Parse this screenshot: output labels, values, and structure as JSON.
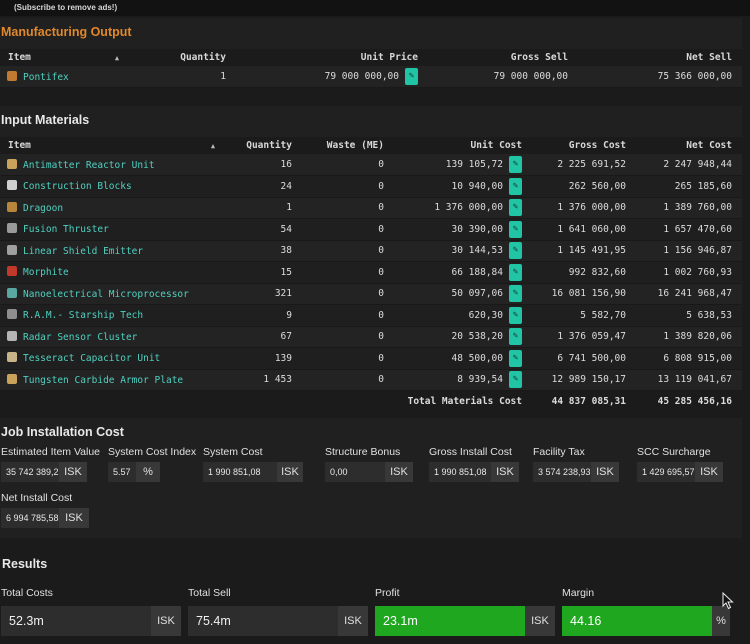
{
  "ad_note": "(Subscribe to remove ads!)",
  "output": {
    "title": "Manufacturing Output",
    "headers": [
      "Item",
      "Quantity",
      "Unit Price",
      "Gross Sell",
      "Net Sell"
    ],
    "rows": [
      {
        "name": "Pontifex",
        "qty": "1",
        "unit_price": "79 000 000,00",
        "gross": "79 000 000,00",
        "net": "75 366 000,00",
        "icon_color": "#c27a30"
      }
    ]
  },
  "materials": {
    "title": "Input Materials",
    "headers": [
      "Item",
      "Quantity",
      "Waste (ME)",
      "Unit Cost",
      "Gross Cost",
      "Net Cost"
    ],
    "rows": [
      {
        "name": "Antimatter Reactor Unit",
        "qty": "16",
        "waste": "0",
        "unit": "139 105,72",
        "gross": "2 225 691,52",
        "net": "2 247 948,44",
        "icon_color": "#c9a35a"
      },
      {
        "name": "Construction Blocks",
        "qty": "24",
        "waste": "0",
        "unit": "10 940,00",
        "gross": "262 560,00",
        "net": "265 185,60",
        "icon_color": "#cfcfcf"
      },
      {
        "name": "Dragoon",
        "qty": "1",
        "waste": "0",
        "unit": "1 376 000,00",
        "gross": "1 376 000,00",
        "net": "1 389 760,00",
        "icon_color": "#b8863a"
      },
      {
        "name": "Fusion Thruster",
        "qty": "54",
        "waste": "0",
        "unit": "30 390,00",
        "gross": "1 641 060,00",
        "net": "1 657 470,60",
        "icon_color": "#9a9a9a"
      },
      {
        "name": "Linear Shield Emitter",
        "qty": "38",
        "waste": "0",
        "unit": "30 144,53",
        "gross": "1 145 491,95",
        "net": "1 156 946,87",
        "icon_color": "#a0a0a0"
      },
      {
        "name": "Morphite",
        "qty": "15",
        "waste": "0",
        "unit": "66 188,84",
        "gross": "992 832,60",
        "net": "1 002 760,93",
        "icon_color": "#c0392b"
      },
      {
        "name": "Nanoelectrical Microprocessor",
        "qty": "321",
        "waste": "0",
        "unit": "50 097,06",
        "gross": "16 081 156,90",
        "net": "16 241 968,47",
        "icon_color": "#5aa6a0"
      },
      {
        "name": "R.A.M.- Starship Tech",
        "qty": "9",
        "waste": "0",
        "unit": "620,30",
        "gross": "5 582,70",
        "net": "5 638,53",
        "icon_color": "#8e8e8e"
      },
      {
        "name": "Radar Sensor Cluster",
        "qty": "67",
        "waste": "0",
        "unit": "20 538,20",
        "gross": "1 376 059,47",
        "net": "1 389 820,06",
        "icon_color": "#b5b5b5"
      },
      {
        "name": "Tesseract Capacitor Unit",
        "qty": "139",
        "waste": "0",
        "unit": "48 500,00",
        "gross": "6 741 500,00",
        "net": "6 808 915,00",
        "icon_color": "#c9b48a"
      },
      {
        "name": "Tungsten Carbide Armor Plate",
        "qty": "1 453",
        "waste": "0",
        "unit": "8 939,54",
        "gross": "12 989 150,17",
        "net": "13 119 041,67",
        "icon_color": "#c9a35a"
      }
    ],
    "total_label": "Total Materials Cost",
    "total_gross": "44 837 085,31",
    "total_net": "45 285 456,16"
  },
  "job": {
    "title": "Job Installation Cost",
    "fields": [
      {
        "label": "Estimated Item Value",
        "value": "35 742 389,25",
        "unit": "ISK"
      },
      {
        "label": "System Cost Index",
        "value": "5.57",
        "unit": "%"
      },
      {
        "label": "System Cost",
        "value": "1 990 851,08",
        "unit": "ISK"
      },
      {
        "label": "Structure Bonus",
        "value": "0,00",
        "unit": "ISK"
      },
      {
        "label": "Gross Install Cost",
        "value": "1 990 851,08",
        "unit": "ISK"
      },
      {
        "label": "Facility Tax",
        "value": "3 574 238,93",
        "unit": "ISK"
      },
      {
        "label": "SCC Surcharge",
        "value": "1 429 695,57",
        "unit": "ISK"
      },
      {
        "label": "Net Install Cost",
        "value": "6 994 785,58",
        "unit": "ISK"
      }
    ]
  },
  "results": {
    "title": "Results",
    "fields": [
      {
        "label": "Total Costs",
        "value": "52.3m",
        "unit": "ISK",
        "positive": false
      },
      {
        "label": "Total Sell",
        "value": "75.4m",
        "unit": "ISK",
        "positive": false
      },
      {
        "label": "Profit",
        "value": "23.1m",
        "unit": "ISK",
        "positive": true
      },
      {
        "label": "Margin",
        "value": "44.16",
        "unit": "%",
        "positive": true
      }
    ]
  }
}
